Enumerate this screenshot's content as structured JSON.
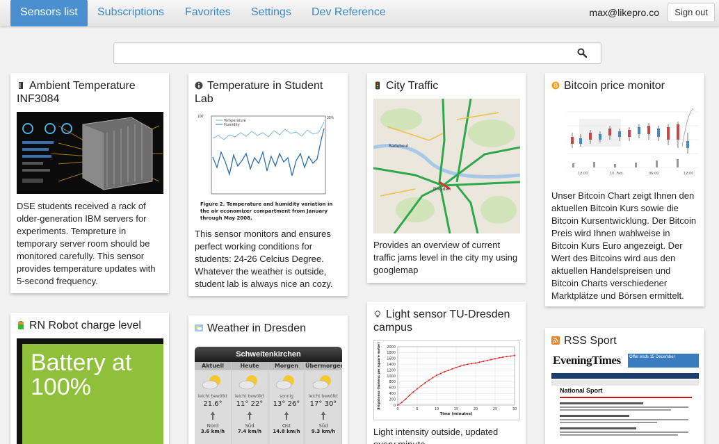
{
  "nav": {
    "tabs": [
      {
        "label": "Sensors list",
        "active": true
      },
      {
        "label": "Subscriptions"
      },
      {
        "label": "Favorites"
      },
      {
        "label": "Settings"
      },
      {
        "label": "Dev Reference"
      }
    ],
    "user_email": "max@likepro.co",
    "signout_label": "Sign out"
  },
  "search": {
    "value": "",
    "placeholder": ""
  },
  "cards": [
    {
      "title": "Ambient Temperature INF3084",
      "icon": "thermometer-icon",
      "description": "DSE students received a rack of older-generation IBM servers for experiments. Tempreture in temporary server room should be monitored carefully. This sensor provides temperature updates with 5-second frequency."
    },
    {
      "title": "Temperature in Student Lab",
      "icon": "info-icon",
      "description": "This sensor monitors and ensures perfect working conditions for students: 24-26 Celcius Degree. Whatever the weather is outside, student lab is always nice an cozy.",
      "caption": "Figure 2. Temperature and humidity variation in the air economizer compartment from January through May 2008.",
      "legend": [
        "Temperature",
        "Humidity"
      ]
    },
    {
      "title": "City Traffic",
      "icon": "traffic-light-icon",
      "description": "Provides an overview of current traffic jams level in the city my using googlemap",
      "map_label_1": "Radebeul",
      "map_label_2": "Dresden"
    },
    {
      "title": "Bitcoin price monitor",
      "icon": "bitcoin-icon",
      "description": "Unser Bitcoin Chart zeigt Ihnen den aktuellen Bitcoin Kurs sowie die Bitcoin Kursentwicklung. Der Bitcoin Preis wird Ihnen wahlweise in Bitcoin Kurs Euro angezeigt. Der Wert des Bitcoins wird aus den aktuellen Handelspreisen und Bitcoin Charts verschiedener Marktplätze und Börsen ermittelt.",
      "x_ticks": [
        "12:00",
        "10. Feb.",
        "06:00",
        "12:00"
      ]
    },
    {
      "title": "RN Robot charge level",
      "icon": "battery-icon",
      "battery_text": "Battery at 100%"
    },
    {
      "title": "Weather in Dresden",
      "icon": "weather-icon",
      "widget_title": "Schweitenkirchen",
      "days": [
        {
          "day": "Aktuell",
          "cond": "leicht bewölkt",
          "temp": "21.6°",
          "wind_dir": "Nord",
          "wind": "3.6 km/h"
        },
        {
          "day": "Heute",
          "cond": "leicht bewölkt",
          "temp": "11° 22°",
          "wind_dir": "Süd",
          "wind": "7.4 km/h"
        },
        {
          "day": "Morgen",
          "cond": "sonnig",
          "temp": "13° 26°",
          "wind_dir": "Ost",
          "wind": "14.8 km/h"
        },
        {
          "day": "Übermorgen",
          "cond": "leicht bewölkt",
          "temp": "17° 30°",
          "wind_dir": "Süd",
          "wind": "9.3 km/h"
        }
      ]
    },
    {
      "title": "Light sensor TU-Dresden campus",
      "icon": "lightbulb-icon",
      "description": "Light intensity outside, updated every minute"
    },
    {
      "title": "RSS Sport",
      "icon": "rss-icon",
      "masthead": "EveningTimes",
      "section": "National Sport",
      "offer_text": "Offer ends 15 December"
    }
  ],
  "chart_data": {
    "type": "line",
    "title": "",
    "xlabel": "Time (minutes)",
    "ylabel": "Brightness (lumens per square meter)",
    "x": [
      0,
      1,
      2,
      3,
      4,
      5,
      6,
      7,
      8,
      9,
      10,
      11,
      12,
      13,
      14,
      15,
      16,
      17,
      18,
      19,
      20,
      21,
      22,
      23,
      24,
      25,
      26,
      27,
      28,
      29,
      30
    ],
    "series": [
      {
        "values": [
          0,
          90,
          200,
          330,
          450,
          560,
          660,
          760,
          850,
          940,
          1020,
          1080,
          1140,
          1190,
          1240,
          1290,
          1330,
          1370,
          1400,
          1420,
          1440,
          1470,
          1500,
          1530,
          1560,
          1590,
          1620,
          1640,
          1660,
          1680,
          1700
        ]
      }
    ],
    "xlim": [
      0,
      30
    ],
    "ylim": [
      0,
      2000
    ],
    "x_ticks": [
      0,
      5,
      10,
      15,
      20,
      25,
      30
    ],
    "y_ticks": [
      0,
      200,
      400,
      600,
      800,
      1000,
      1200,
      1400,
      1600,
      1800,
      2000
    ],
    "color": "#e03030",
    "grid": true
  }
}
